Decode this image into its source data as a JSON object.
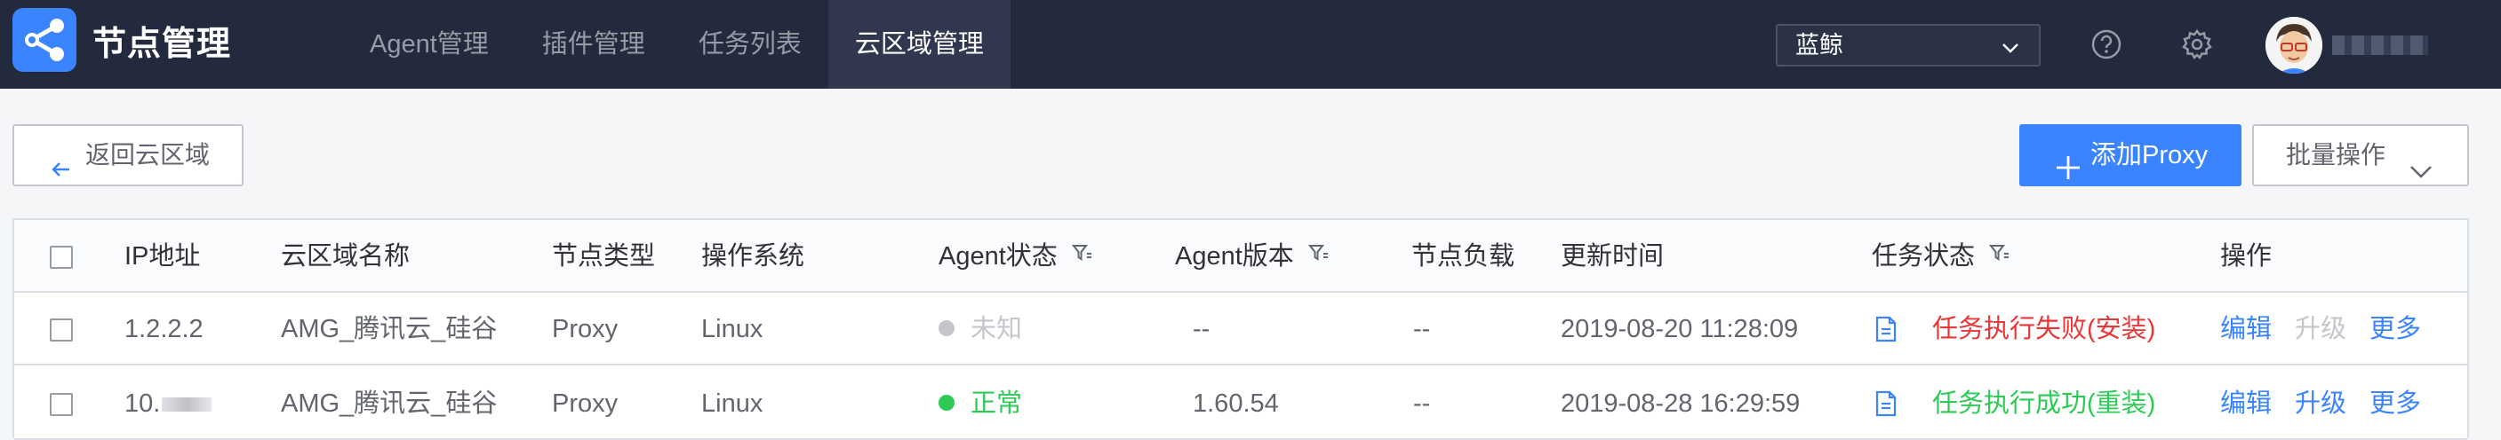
{
  "header": {
    "app_title": "节点管理",
    "nav": [
      {
        "label": "Agent管理",
        "active": false
      },
      {
        "label": "插件管理",
        "active": false
      },
      {
        "label": "任务列表",
        "active": false
      },
      {
        "label": "云区域管理",
        "active": true
      }
    ],
    "business_select": {
      "value": "蓝鲸",
      "icon": "chevron-down-icon"
    },
    "help_icon": "help-icon",
    "settings_icon": "gear-icon"
  },
  "toolbar": {
    "back_label": "返回云区域",
    "add_label": "添加Proxy",
    "batch_label": "批量操作"
  },
  "table": {
    "columns": [
      "IP地址",
      "云区域名称",
      "节点类型",
      "操作系统",
      "Agent状态",
      "Agent版本",
      "节点负载",
      "更新时间",
      "任务状态",
      "操作"
    ],
    "rows": [
      {
        "ip": "1.2.2.2",
        "cloud_name": "AMG_腾讯云_硅谷",
        "node_type": "Proxy",
        "os": "Linux",
        "agent_status": "未知",
        "agent_version": "--",
        "load": "--",
        "updated": "2019-08-20 11:28:09",
        "task_status": "任务执行失败(安装)",
        "actions": {
          "edit": "编辑",
          "upgrade": "升级",
          "more": "更多"
        }
      },
      {
        "ip": "10.",
        "cloud_name": "AMG_腾讯云_硅谷",
        "node_type": "Proxy",
        "os": "Linux",
        "agent_status": "正常",
        "agent_version": "1.60.54",
        "load": "--",
        "updated": "2019-08-28 16:29:59",
        "task_status": "任务执行成功(重装)",
        "actions": {
          "edit": "编辑",
          "upgrade": "升级",
          "more": "更多"
        }
      }
    ]
  },
  "colors": {
    "nav_bg": "#232a3d",
    "primary": "#3a84ff",
    "success": "#2dcb56",
    "danger": "#ea3636",
    "muted": "#c4c6cc"
  }
}
